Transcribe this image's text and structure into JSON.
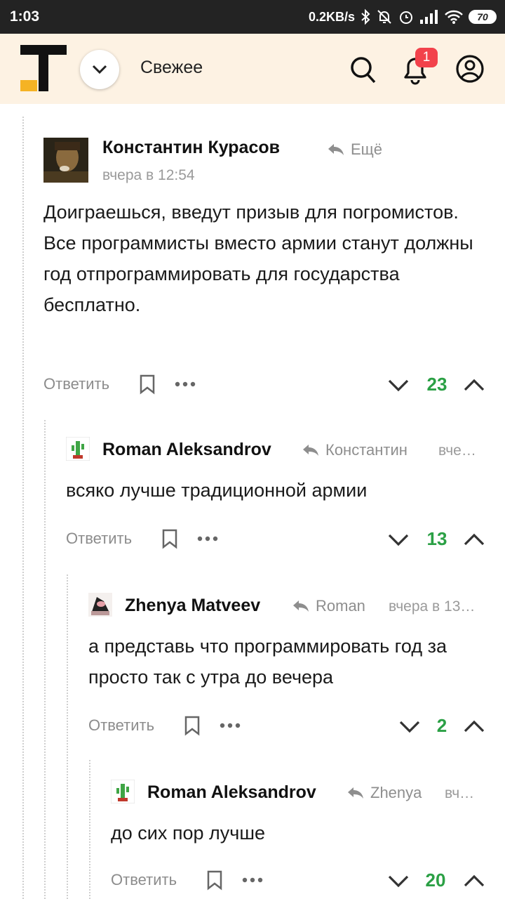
{
  "status_bar": {
    "time": "1:03",
    "speed": "0.2KB/s",
    "battery": "70"
  },
  "header": {
    "feed_title": "Свежее",
    "notification_count": "1"
  },
  "comments": [
    {
      "author": "Константин Курасов",
      "reply_to": "Ещё",
      "time": "вчера в 12:54",
      "text": "Доиграешься, введут призыв для погромистов. Все программисты вместо армии станут должны год отпрограммировать для государства бесплатно.",
      "reply_label": "Ответить",
      "score": "23"
    },
    {
      "author": "Roman Aleksandrov",
      "reply_to": "Константин",
      "time": "вче…",
      "text": "всяко лучше традиционной армии",
      "reply_label": "Ответить",
      "score": "13"
    },
    {
      "author": "Zhenya Matveev",
      "reply_to": "Roman",
      "time": "вчера в 13…",
      "text": "а представь что программировать год за просто так с утра до вечера",
      "reply_label": "Ответить",
      "score": "2"
    },
    {
      "author": "Roman Aleksandrov",
      "reply_to": "Zhenya",
      "time": "вч…",
      "text": "до сих пор лучше",
      "reply_label": "Ответить",
      "score": "20"
    }
  ],
  "colors": {
    "accent_green": "#2ba045",
    "header_bg": "#fdf2e3",
    "badge": "#f2424b"
  }
}
